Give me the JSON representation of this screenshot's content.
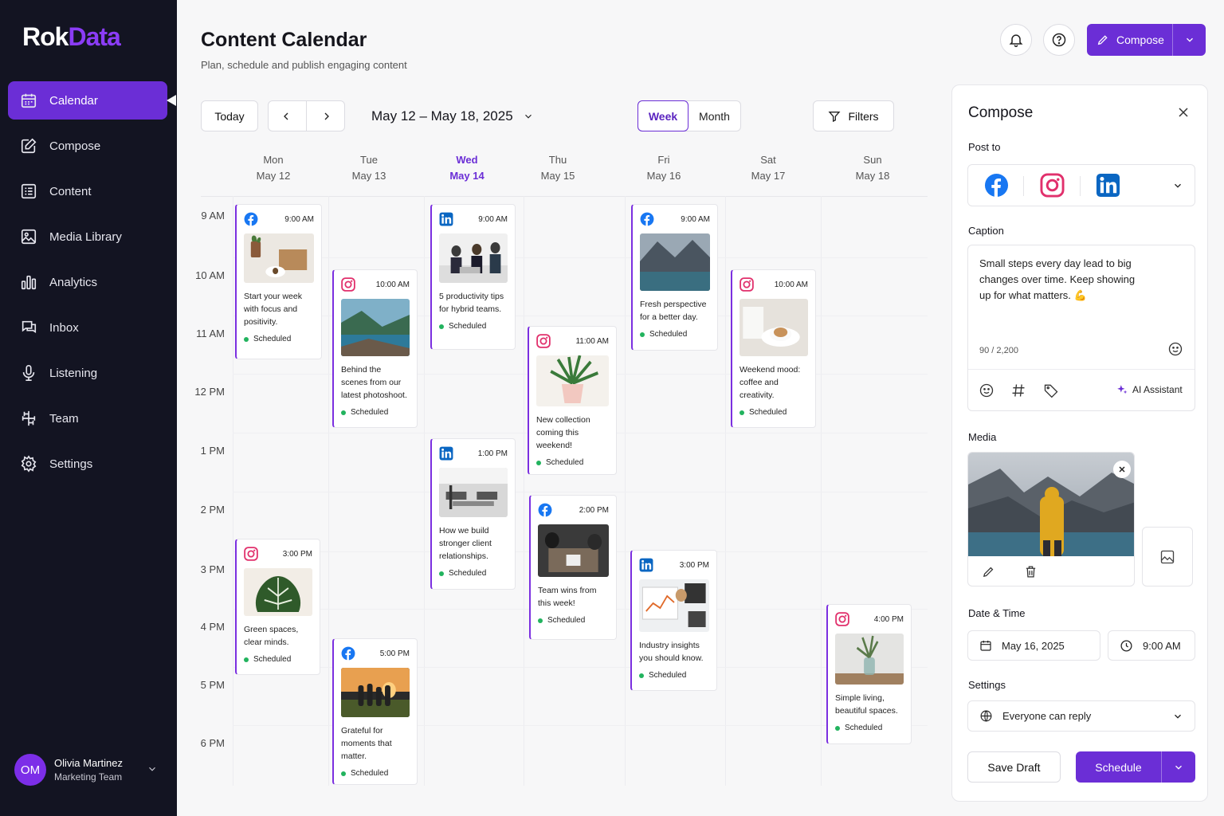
{
  "app": {
    "logo_part1": "Rok",
    "logo_part2": "Data"
  },
  "sidebar": {
    "items": [
      {
        "label": "Calendar",
        "icon": "calendar-icon",
        "active": true
      },
      {
        "label": "Compose",
        "icon": "edit-icon"
      },
      {
        "label": "Content",
        "icon": "content-list-icon"
      },
      {
        "label": "Media Library",
        "icon": "image-icon"
      },
      {
        "label": "Analytics",
        "icon": "bar-chart-icon"
      },
      {
        "label": "Inbox",
        "icon": "chat-bubbles-icon"
      },
      {
        "label": "Listening",
        "icon": "microphone-icon"
      },
      {
        "label": "Team",
        "icon": "team-icon"
      },
      {
        "label": "Settings",
        "icon": "gear-icon"
      }
    ],
    "user": {
      "initials": "OM",
      "name": "Olivia Martinez",
      "role": "Marketing Team"
    }
  },
  "header": {
    "title": "Content Calendar",
    "subtitle": "Plan, schedule and publish engaging content",
    "compose_label": "Compose"
  },
  "toolbar": {
    "today": "Today",
    "range": "May 12 – May 18, 2025",
    "week": "Week",
    "month": "Month",
    "filters": "Filters"
  },
  "days": [
    {
      "name": "Mon",
      "date": "May 12"
    },
    {
      "name": "Tue",
      "date": "May 13"
    },
    {
      "name": "Wed",
      "date": "May 14",
      "today": true
    },
    {
      "name": "Thu",
      "date": "May 15"
    },
    {
      "name": "Fri",
      "date": "May 16"
    },
    {
      "name": "Sat",
      "date": "May 17"
    },
    {
      "name": "Sun",
      "date": "May 18"
    }
  ],
  "hours": [
    "9 AM",
    "10 AM",
    "11 AM",
    "12 PM",
    "1 PM",
    "2 PM",
    "3 PM",
    "4 PM",
    "5 PM",
    "6 PM"
  ],
  "posts": [
    {
      "day": "Mon",
      "platform": "facebook",
      "time": "9:00 AM",
      "text": "Start your week with focus and positivity.",
      "status": "Scheduled"
    },
    {
      "day": "Mon",
      "platform": "instagram",
      "time": "3:00 PM",
      "text": "Green spaces, clear minds.",
      "status": "Scheduled"
    },
    {
      "day": "Tue",
      "platform": "instagram",
      "time": "10:00 AM",
      "text": "Behind the scenes from our latest photoshoot.",
      "status": "Scheduled"
    },
    {
      "day": "Tue",
      "platform": "facebook",
      "time": "5:00 PM",
      "text": "Grateful for moments that matter.",
      "status": "Scheduled"
    },
    {
      "day": "Wed",
      "platform": "linkedin",
      "time": "9:00 AM",
      "text": "5 productivity tips for hybrid teams.",
      "status": "Scheduled"
    },
    {
      "day": "Wed",
      "platform": "linkedin",
      "time": "1:00 PM",
      "text": "How we build stronger client relationships.",
      "status": "Scheduled"
    },
    {
      "day": "Thu",
      "platform": "instagram",
      "time": "11:00 AM",
      "text": "New collection coming this weekend!",
      "status": "Scheduled"
    },
    {
      "day": "Thu",
      "platform": "facebook",
      "time": "2:00 PM",
      "text": "Team wins from this week!",
      "status": "Scheduled"
    },
    {
      "day": "Fri",
      "platform": "facebook",
      "time": "9:00 AM",
      "text": "Fresh perspective for a better day.",
      "status": "Scheduled"
    },
    {
      "day": "Fri",
      "platform": "linkedin",
      "time": "3:00 PM",
      "text": "Industry insights you should know.",
      "status": "Scheduled"
    },
    {
      "day": "Sat",
      "platform": "instagram",
      "time": "10:00 AM",
      "text": "Weekend mood: coffee and creativity.",
      "status": "Scheduled"
    },
    {
      "day": "Sun",
      "platform": "instagram",
      "time": "4:00 PM",
      "text": "Simple living, beautiful spaces.",
      "status": "Scheduled"
    }
  ],
  "compose": {
    "title": "Compose",
    "post_to": "Post to",
    "platforms": [
      "facebook",
      "instagram",
      "linkedin"
    ],
    "caption_label": "Caption",
    "caption": "Small steps every day lead to big changes over time. Keep showing up for what matters. 💪",
    "char_count": "90 / 2,200",
    "ai_label": "AI Assistant",
    "media_label": "Media",
    "datetime_label": "Date & Time",
    "date": "May 16, 2025",
    "time": "9:00 AM",
    "settings_label": "Settings",
    "reply_setting": "Everyone can reply",
    "save_draft": "Save Draft",
    "schedule": "Schedule"
  },
  "colors": {
    "accent": "#6b2ed6",
    "sidebar_bg": "#131422",
    "facebook": "#1877f2",
    "instagram": "#e1306c",
    "linkedin": "#0a66c2",
    "scheduled": "#22b35e"
  }
}
